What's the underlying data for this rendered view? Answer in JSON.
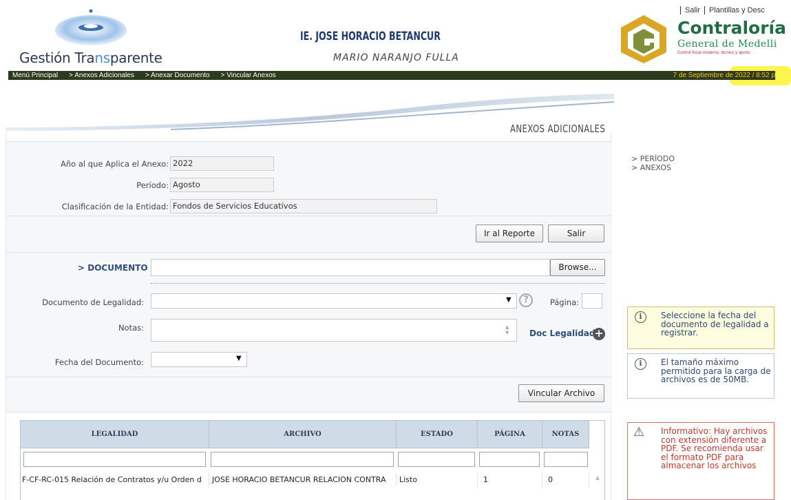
{
  "header": {
    "brand_main": "Gestión Tra",
    "brand_accent": "ns",
    "brand_end": "parente",
    "school_name": "IE. JOSE HORACIO BETANCUR",
    "person_name": "MARIO NARANJO FULLA",
    "links": [
      "Salir",
      "Plantillas y Desc"
    ],
    "contraloria_title": "Contraloría",
    "contraloria_sub": "General de Medelli",
    "contraloria_slogan": "Control fiscal moderno, técnico y oportu"
  },
  "navbar": {
    "crumbs": [
      "Menú Principal",
      "> Anexos Adicionales",
      "> Anexar Documento",
      "> Vincular Anexos"
    ],
    "date": "7 de Septiembre de 2022 / 8:52 p"
  },
  "main": {
    "section_title": "ANEXOS ADICIONALES",
    "year_label": "Año al que Aplica el Anexo:",
    "year_value": "2022",
    "period_label": "Período:",
    "period_value": "Agosto",
    "class_label": "Clasificación de la Entidad:",
    "class_value": "Fondos de Servicios Educativos",
    "report_button": "Ir al Reporte",
    "exit_button": "Salir",
    "document_label": "> DOCUMENTO",
    "browse_button": "Browse...",
    "legal_doc_label": "Documento de Legalidad:",
    "page_label": "Página:",
    "notes_label": "Notas:",
    "doc_legal_link": "Doc Legalidad",
    "doc_date_label": "Fecha del Documento:",
    "link_file_button": "Vincular Archivo"
  },
  "table": {
    "headers": [
      "LEGALIDAD",
      "ARCHIVO",
      "ESTADO",
      "PÁGINA",
      "NOTAS"
    ],
    "rows": [
      [
        "F-CF-RC-015 Relación de Contratos y/u Orden d",
        "JOSE HORACIO BETANCUR RELACION CONTRA",
        "Listo",
        "1",
        "0"
      ]
    ]
  },
  "sidebar": {
    "nav": [
      "> PERÍODO",
      "> ANEXOS"
    ],
    "tip_date": "Seleccione la fecha del documento de legalidad a registrar.",
    "tip_size": "El tamaño máximo permitido para la carga de archivos es de 50MB.",
    "tip_warn": "Informativo: Hay archivos con extensión diferente a PDF. Se recomienda usar el formato PDF para almacenar los archivos"
  },
  "colors": {
    "navbar_bg": "#2d3a1e",
    "date_color": "#f3c20c",
    "header_blue": "#1f3a6e",
    "contraloria_green": "#1f6e43",
    "table_header": "#cfdce8"
  }
}
